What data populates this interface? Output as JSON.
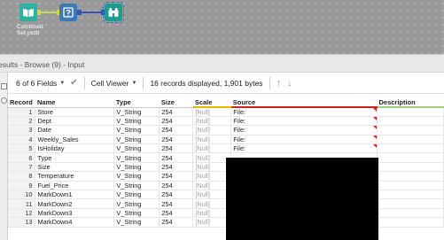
{
  "workflow": {
    "tools": [
      {
        "name": "input-data-tool",
        "icon": "book-icon"
      },
      {
        "name": "select-tool",
        "icon": "select-icon"
      },
      {
        "name": "browse-tool",
        "icon": "binoculars-icon"
      }
    ],
    "input_label": "Combined Set.yxdb"
  },
  "results": {
    "title": "esults - Browse (9) - Input"
  },
  "toolbar": {
    "fields_label": "6 of 6 Fields",
    "viewer_label": "Cell Viewer",
    "summary": "16 records displayed, 1,901 bytes"
  },
  "grid": {
    "columns": [
      "Record",
      "Name",
      "Type",
      "Size",
      "Scale",
      "Source",
      "Description"
    ],
    "rows": [
      {
        "record": "1",
        "name": "Store",
        "type": "V_String",
        "size": "254",
        "scale": "[Null]",
        "source": "File:"
      },
      {
        "record": "2",
        "name": "Dept",
        "type": "V_String",
        "size": "254",
        "scale": "[Null]",
        "source": "File:"
      },
      {
        "record": "3",
        "name": "Date",
        "type": "V_String",
        "size": "254",
        "scale": "[Null]",
        "source": "File:"
      },
      {
        "record": "4",
        "name": "Weekly_Sales",
        "type": "V_String",
        "size": "254",
        "scale": "[Null]",
        "source": "File:"
      },
      {
        "record": "5",
        "name": "IsHoliday",
        "type": "V_String",
        "size": "254",
        "scale": "[Null]",
        "source": "File:"
      },
      {
        "record": "6",
        "name": "Type",
        "type": "V_String",
        "size": "254",
        "scale": "[Null]",
        "source": ""
      },
      {
        "record": "7",
        "name": "Size",
        "type": "V_String",
        "size": "254",
        "scale": "[Null]",
        "source": ""
      },
      {
        "record": "8",
        "name": "Temperature",
        "type": "V_String",
        "size": "254",
        "scale": "[Null]",
        "source": ""
      },
      {
        "record": "9",
        "name": "Fuel_Price",
        "type": "V_String",
        "size": "254",
        "scale": "[Null]",
        "source": ""
      },
      {
        "record": "10",
        "name": "MarkDown1",
        "type": "V_String",
        "size": "254",
        "scale": "[Null]",
        "source": ""
      },
      {
        "record": "11",
        "name": "MarkDown2",
        "type": "V_String",
        "size": "254",
        "scale": "[Null]",
        "source": ""
      },
      {
        "record": "12",
        "name": "MarkDown3",
        "type": "V_String",
        "size": "254",
        "scale": "[Null]",
        "source": ""
      },
      {
        "record": "13",
        "name": "MarkDown4",
        "type": "V_String",
        "size": "254",
        "scale": "[Null]",
        "source": ""
      }
    ]
  },
  "colors": {
    "canvas": "#9a9a9a",
    "input_tool": "#2bb3a0",
    "select_tool": "#3c79b5",
    "browse_tool": "#1c9c8c",
    "connection_input": "#c9d94a",
    "connection_output": "#3a52b8",
    "scale_header_underline": "#e6b800",
    "source_header_underline": "#d12020",
    "description_header_underline": "#9bd27a",
    "null_text": "#a0a0a0",
    "cell_warning": "#d12020"
  }
}
